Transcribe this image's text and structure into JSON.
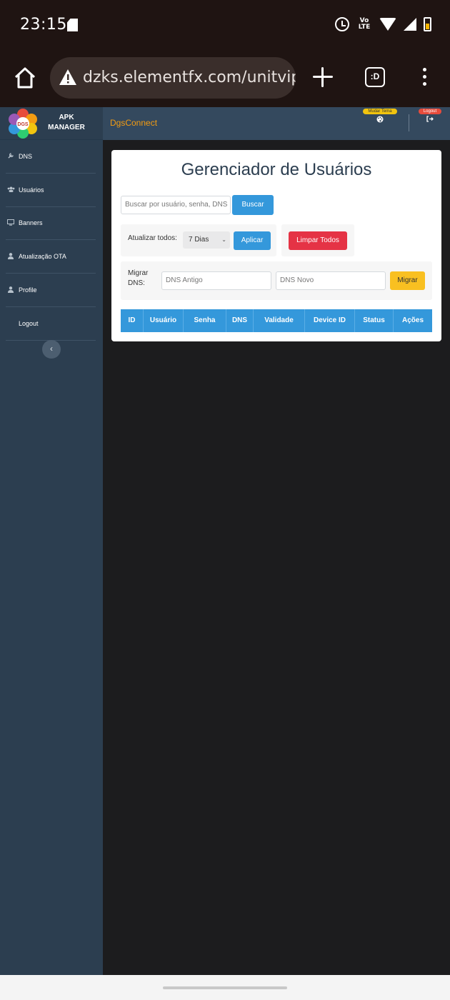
{
  "status_bar": {
    "time": "23:15",
    "network": "Vo LTE"
  },
  "browser": {
    "url": "dzks.elementfx.com/unitvip",
    "tabs_label": ":D"
  },
  "sidebar": {
    "brand_line1": "APK",
    "brand_line2": "MANAGER",
    "logo_text": "DGS",
    "items": [
      {
        "label": "DNS",
        "icon": "wrench-icon"
      },
      {
        "label": "Usuários",
        "icon": "users-icon"
      },
      {
        "label": "Banners",
        "icon": "monitor-icon"
      },
      {
        "label": "Atualização OTA",
        "icon": "user-icon"
      },
      {
        "label": "Profile",
        "icon": "user-icon"
      },
      {
        "label": "Logout",
        "icon": ""
      }
    ],
    "collapse_label": "‹"
  },
  "topbar": {
    "app_name": "DgsConnect",
    "theme_badge": "Mudar Tema",
    "logout_badge": "Logout"
  },
  "main": {
    "title": "Gerenciador de Usuários",
    "search_placeholder": "Buscar por usuário, senha, DNS",
    "search_button": "Buscar",
    "update_all_label": "Atualizar todos:",
    "update_select_value": "7 Dias",
    "apply_button": "Aplicar",
    "clear_all_button": "Limpar Todos",
    "migrate_label_line1": "Migrar",
    "migrate_label_line2": "DNS:",
    "old_dns_placeholder": "DNS Antigo",
    "new_dns_placeholder": "DNS Novo",
    "migrate_button": "Migrar",
    "table_headers": [
      "ID",
      "Usuário",
      "Senha",
      "DNS",
      "Validade",
      "Device ID",
      "Status",
      "Ações"
    ]
  },
  "colors": {
    "sidebar": "#2c3e50",
    "topbar": "#34495e",
    "accent_blue": "#3498db",
    "danger_red": "#e53345",
    "warning_yellow": "#f9c021",
    "brand_orange": "#f39c12"
  }
}
